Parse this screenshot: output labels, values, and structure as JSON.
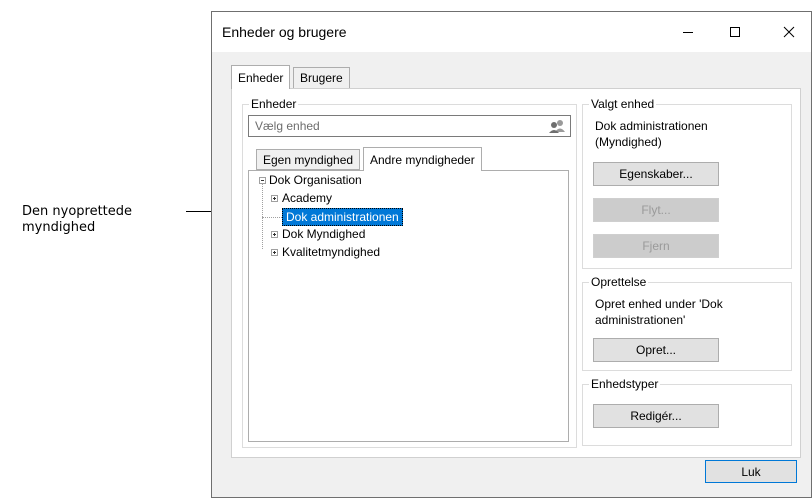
{
  "callout": {
    "line1": "Den nyoprettede",
    "line2": "myndighed"
  },
  "window": {
    "title": "Enheder og brugere"
  },
  "main_tabs": [
    {
      "label": "Enheder"
    },
    {
      "label": "Brugere"
    }
  ],
  "units": {
    "group_label": "Enheder",
    "search_placeholder": "Vælg enhed",
    "sub_tabs": [
      {
        "label": "Egen myndighed"
      },
      {
        "label": "Andre myndigheder"
      }
    ],
    "tree": {
      "root": "Dok Organisation",
      "children": [
        "Academy",
        "Dok administrationen",
        "Dok Myndighed",
        "Kvalitetmyndighed"
      ],
      "selected": "Dok administrationen"
    }
  },
  "selected_unit": {
    "group_label": "Valgt enhed",
    "name_line1": "Dok administrationen",
    "name_line2": "(Myndighed)",
    "properties_button": "Egenskaber...",
    "move_button": "Flyt...",
    "remove_button": "Fjern"
  },
  "creation": {
    "group_label": "Oprettelse",
    "text_line1": "Opret enhed under 'Dok",
    "text_line2": "administrationen'",
    "create_button": "Opret..."
  },
  "unit_types": {
    "group_label": "Enhedstyper",
    "edit_button": "Redigér..."
  },
  "close_button": "Luk",
  "colors": {
    "selection": "#0078d7",
    "window_bg": "#f0f0f0"
  }
}
